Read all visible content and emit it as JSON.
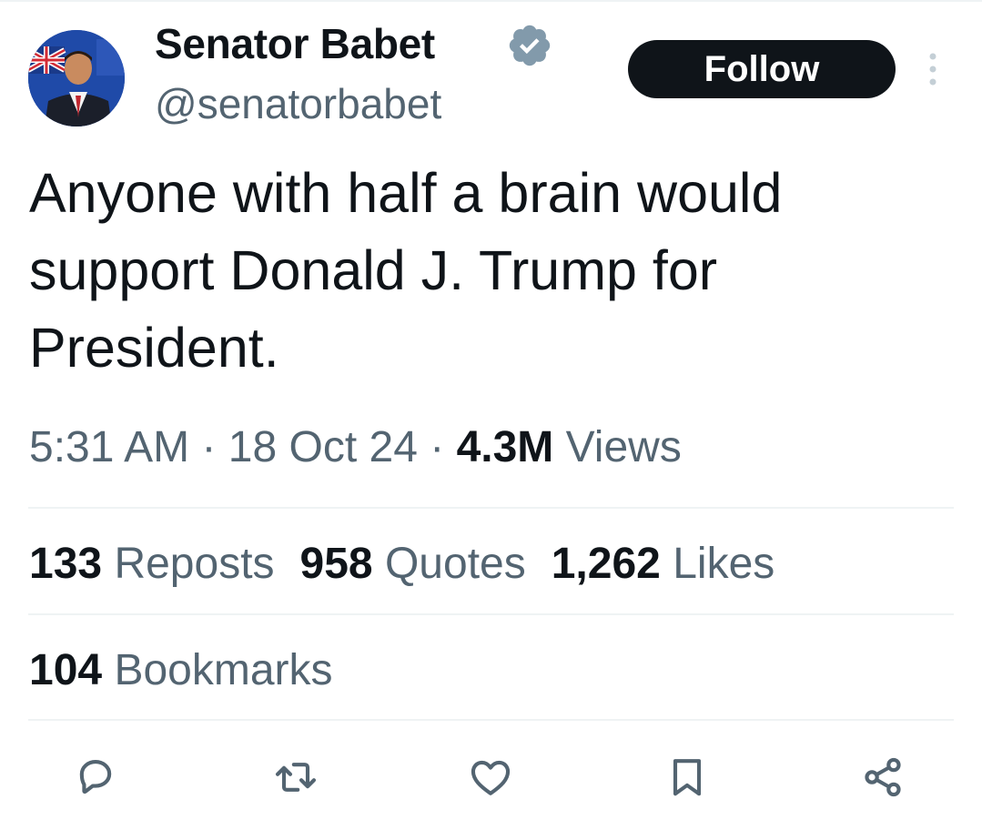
{
  "author": {
    "display_name": "Senator Babet",
    "handle": "@senatorbabet",
    "verified": true
  },
  "follow_label": "Follow",
  "tweet": {
    "text": "Anyone with half a brain would support Donald J. Trump for President.",
    "time": "5:31 AM",
    "separator": "·",
    "date": "18 Oct 24",
    "views_count": "4.3M",
    "views_label": "Views"
  },
  "stats": {
    "reposts_count": "133",
    "reposts_label": "Reposts",
    "quotes_count": "958",
    "quotes_label": "Quotes",
    "likes_count": "1,262",
    "likes_label": "Likes",
    "bookmarks_count": "104",
    "bookmarks_label": "Bookmarks"
  },
  "actions": [
    "reply-icon",
    "repost-icon",
    "like-icon",
    "bookmark-icon",
    "share-icon"
  ],
  "colors": {
    "text": "#0f1419",
    "secondary": "#536471",
    "verified": "#829aab",
    "divider": "#eff3f4",
    "button": "#0f1419"
  }
}
